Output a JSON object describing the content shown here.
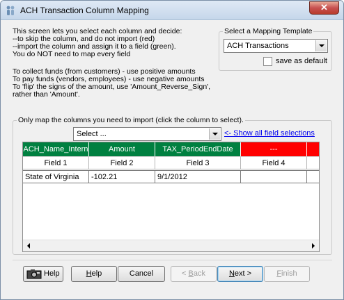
{
  "window": {
    "title": "ACH Transaction Column Mapping",
    "close_glyph": "✕"
  },
  "instructions": {
    "line1": "This screen lets you select each column and decide:",
    "line2": "--to skip the column, and do not import (red)",
    "line3": "--import the column and assign it to a field (green).",
    "line4": "You do NOT need to map every field",
    "line5": "To collect funds (from customers) - use positive amounts",
    "line6": "To pay funds (vendors, employees) - use negative amounts",
    "line7": "To 'flip' the signs of the amount, use 'Amount_Reverse_Sign',",
    "line8": "rather than 'Amount'."
  },
  "template": {
    "group_title": "Select a Mapping Template",
    "selected": "ACH Transactions",
    "save_default_label": "save as default",
    "save_default_checked": false
  },
  "mapping": {
    "group_title": "Only map the columns you need to import (click the column to select).",
    "select_value": "Select ...",
    "show_all_link": "<- Show all field selections",
    "columns": [
      {
        "assignment": "ACH_Name_Intern",
        "field": "Field 1",
        "value": "State of Virginia",
        "color": "#008040"
      },
      {
        "assignment": "Amount",
        "field": "Field 2",
        "value": "-102.21",
        "color": "#008040"
      },
      {
        "assignment": "TAX_PeriodEndDate",
        "field": "Field 3",
        "value": "9/1/2012",
        "color": "#008040"
      },
      {
        "assignment": "---",
        "field": "Field 4",
        "value": "",
        "color": "#ff0000"
      },
      {
        "assignment": "",
        "field": "",
        "value": "",
        "color": "#ff0000"
      }
    ]
  },
  "buttons": {
    "help_icon_label": "Help",
    "help_rest": "elp",
    "help_accel": "H",
    "cancel": "Cancel",
    "back_accel": "B",
    "back_prefix": "< ",
    "back_rest": "ack",
    "next_accel": "N",
    "next_rest": "ext >",
    "finish_accel": "F",
    "finish_rest": "inish"
  },
  "colors": {
    "mapped": "#008040",
    "skipped": "#ff0000"
  }
}
